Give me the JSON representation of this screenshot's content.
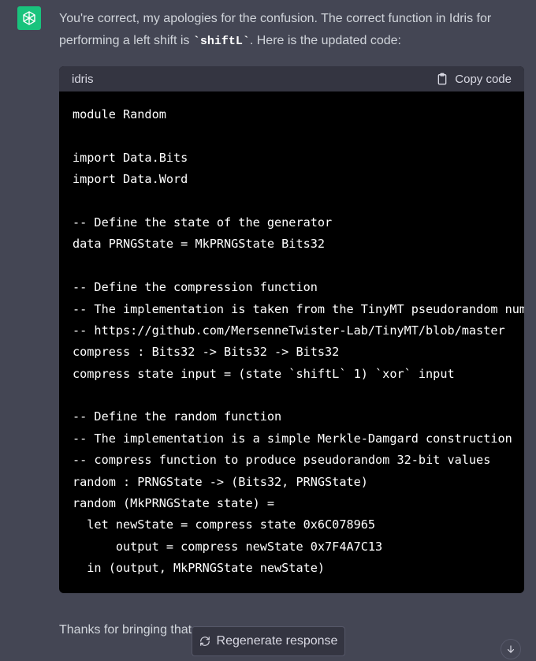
{
  "message": {
    "intro_before": "You're correct, my apologies for the confusion. The correct function in Idris for performing a left shift is ",
    "intro_code": "`shiftL`",
    "intro_after": ". Here is the updated code:"
  },
  "code_block": {
    "language": "idris",
    "copy_label": "Copy code",
    "lines": [
      "module Random",
      "",
      "import Data.Bits",
      "import Data.Word",
      "",
      "-- Define the state of the generator",
      "data PRNGState = MkPRNGState Bits32",
      "",
      "-- Define the compression function",
      "-- The implementation is taken from the TinyMT pseudorandom number generator",
      "-- https://github.com/MersenneTwister-Lab/TinyMT/blob/master",
      "compress : Bits32 -> Bits32 -> Bits32",
      "compress state input = (state `shiftL` 1) `xor` input",
      "",
      "-- Define the random function",
      "-- The implementation is a simple Merkle-Damgard construction",
      "-- compress function to produce pseudorandom 32-bit values",
      "random : PRNGState -> (Bits32, PRNGState)",
      "random (MkPRNGState state) =",
      "  let newState = compress state 0x6C078965",
      "      output = compress newState 0x7F4A7C13",
      "  in (output, MkPRNGState newState)"
    ]
  },
  "followup_text": "Thanks for bringing that",
  "regenerate_label": "Regenerate response",
  "colors": {
    "background": "#444654",
    "avatar": "#19c37d",
    "code_bg": "#000000",
    "code_header": "#343541"
  },
  "icons": [
    "openai-logo-icon",
    "clipboard-icon",
    "refresh-icon",
    "arrow-down-icon"
  ]
}
